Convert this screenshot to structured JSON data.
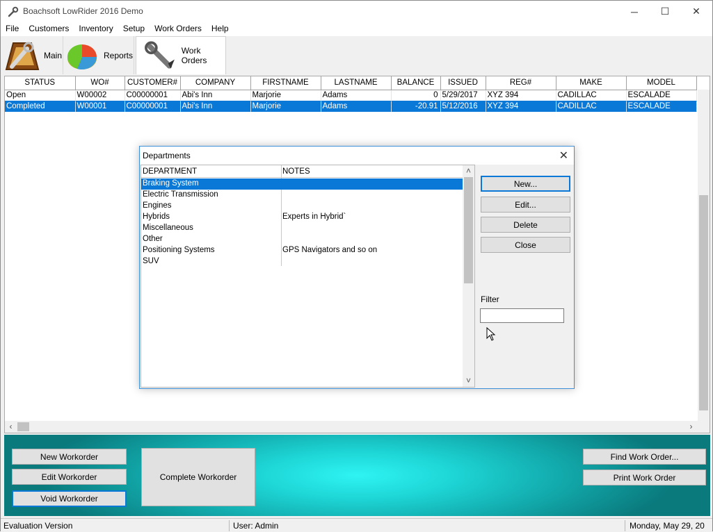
{
  "window": {
    "title": "Boachsoft LowRider 2016 Demo",
    "minimize": "─",
    "maximize": "☐",
    "close": "✕"
  },
  "menu": [
    "File",
    "Customers",
    "Inventory",
    "Setup",
    "Work Orders",
    "Help"
  ],
  "tabs": [
    {
      "label": "Main",
      "icon": "wrench-gauge-icon"
    },
    {
      "label": "Reports",
      "icon": "pie-chart-icon"
    },
    {
      "label": "Work Orders",
      "icon": "wrench-icon"
    }
  ],
  "grid": {
    "columns": [
      "STATUS",
      "WO#",
      "CUSTOMER#",
      "COMPANY",
      "FIRSTNAME",
      "LASTNAME",
      "BALANCE",
      "ISSUED",
      "REG#",
      "MAKE",
      "MODEL"
    ],
    "rows": [
      [
        "Open",
        "W00002",
        "C00000001",
        "Abi's Inn",
        "Marjorie",
        "Adams",
        "0",
        "5/29/2017",
        "XYZ 394",
        "CADILLAC",
        "ESCALADE"
      ],
      [
        "Completed",
        "W00001",
        "C00000001",
        "Abi's Inn",
        "Marjorie",
        "Adams",
        "-20.91",
        "5/12/2016",
        "XYZ 394",
        "CADILLAC",
        "ESCALADE"
      ]
    ]
  },
  "panel": {
    "new_workorder": "New Workorder",
    "edit_workorder": "Edit Workorder",
    "void_workorder": "Void Workorder",
    "complete_workorder": "Complete Workorder",
    "find_work_order": "Find Work Order...",
    "print_work_order": "Print Work Order"
  },
  "status": {
    "version": "Evaluation Version",
    "user": "User: Admin",
    "date": "Monday, May 29, 20"
  },
  "dialog": {
    "title": "Departments",
    "close": "✕",
    "headers": [
      "DEPARTMENT",
      "NOTES"
    ],
    "rows": [
      [
        "Braking System",
        ""
      ],
      [
        "Electric Transmission",
        ""
      ],
      [
        "Engines",
        ""
      ],
      [
        "Hybrids",
        "Experts in Hybrid`"
      ],
      [
        "Miscellaneous",
        ""
      ],
      [
        "Other",
        ""
      ],
      [
        "Positioning Systems",
        "GPS Navigators and so on"
      ],
      [
        "SUV",
        ""
      ]
    ],
    "buttons": {
      "new": "New...",
      "edit": "Edit...",
      "delete": "Delete",
      "close": "Close"
    },
    "filter_label": "Filter",
    "filter_value": ""
  }
}
